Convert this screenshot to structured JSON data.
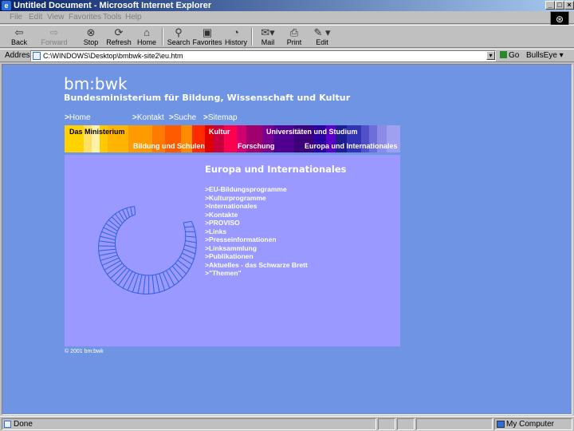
{
  "window": {
    "title": "Untitled Document - Microsoft Internet Explorer",
    "controls": [
      "_",
      "□",
      "×"
    ]
  },
  "menu": [
    "File",
    "Edit",
    "View",
    "Favorites",
    "Tools",
    "Help"
  ],
  "toolbar": {
    "back": "Back",
    "forward": "Forward",
    "stop": "Stop",
    "refresh": "Refresh",
    "home": "Home",
    "search": "Search",
    "favorites": "Favorites",
    "history": "History",
    "mail": "Mail",
    "print": "Print",
    "edit": "Edit"
  },
  "address": {
    "label": "Address",
    "url": "C:\\WINDOWS\\Desktop\\bmbwk-site2\\eu.htm",
    "go": "Go",
    "bullseye": "BullsEye"
  },
  "page": {
    "logo": "bm:bwk",
    "ministry": "Bundesministerium für Bildung, Wissenschaft und Kultur",
    "topnav": {
      "home": "Home",
      "kontakt": "Kontakt",
      "suche": "Suche",
      "sitemap": "Sitemap"
    },
    "categories": {
      "ministerium": "Das Ministerium",
      "bildung": "Bildung und Schulen",
      "kultur": "Kultur",
      "forschung": "Forschung",
      "universitaeten": "Universitäten und Studium",
      "europa": "Europa und Internationales"
    },
    "heading": "Europa und Internationales",
    "links": [
      ">EU-Bildungsprogramme",
      ">Kulturprogramme",
      ">Internationales",
      ">Kontakte",
      ">PROVISO",
      ">Links",
      ">Presseinformationen",
      ">Linksammlung",
      ">Publikationen",
      ">Aktuelles - das Schwarze Brett",
      ">\"Themen\""
    ],
    "copyright": "© 2001 bm:bwk"
  },
  "status": {
    "text": "Done",
    "zone": "My Computer"
  },
  "colors": {
    "page_background": "#6f94e3",
    "panel_background": "#9999ff",
    "spiral": "#2f5fe0"
  },
  "icons": [
    "ie-icon",
    "back-icon",
    "forward-icon",
    "stop-icon",
    "refresh-icon",
    "home-icon",
    "search-icon",
    "favorites-icon",
    "history-icon",
    "mail-icon",
    "print-icon",
    "edit-icon",
    "page-icon",
    "go-icon",
    "computer-icon",
    "spiral-graphic"
  ]
}
